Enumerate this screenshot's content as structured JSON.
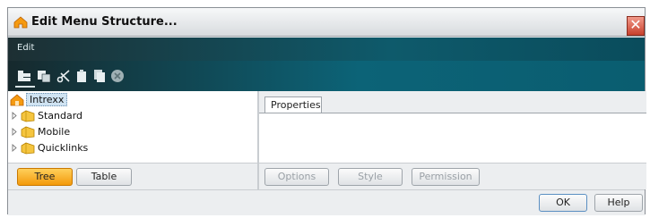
{
  "window": {
    "title": "Edit Menu Structure...",
    "close_glyph": "✕"
  },
  "menubar": {
    "edit_label": "Edit"
  },
  "toolbar": {
    "icons": [
      "add-item-icon",
      "add-child-icon",
      "cut-icon",
      "paste-icon",
      "copy-icon",
      "delete-icon"
    ]
  },
  "tree": {
    "root": "Intrexx",
    "items": [
      {
        "label": "Standard"
      },
      {
        "label": "Mobile"
      },
      {
        "label": "Quicklinks"
      }
    ]
  },
  "view_buttons": {
    "tree": "Tree",
    "table": "Table"
  },
  "properties": {
    "tab": "Properties",
    "buttons": {
      "options": "Options",
      "style": "Style",
      "permission": "Permission"
    }
  },
  "dialog": {
    "ok": "OK",
    "help": "Help"
  },
  "colors": {
    "accent_orange": "#f39a0c",
    "toolbar_teal": "#0c6377",
    "selection_blue": "#cfe3f2"
  }
}
